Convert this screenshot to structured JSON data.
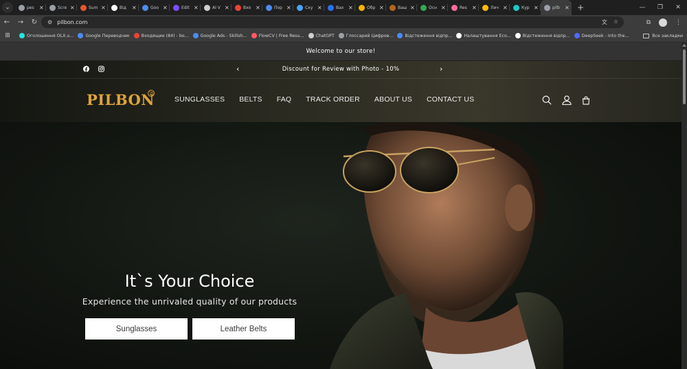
{
  "browser": {
    "tabs": [
      {
        "title": "pes",
        "color": "#9aa0a6"
      },
      {
        "title": "Scre",
        "color": "#9aa0a6"
      },
      {
        "title": "Sum",
        "color": "#e8542f"
      },
      {
        "title": "Від",
        "color": "#ffffff"
      },
      {
        "title": "Goo",
        "color": "#4c8bf5"
      },
      {
        "title": "Edit",
        "color": "#7c4dff"
      },
      {
        "title": "AI V",
        "color": "#cfcfcf"
      },
      {
        "title": "Вхо",
        "color": "#ea4335"
      },
      {
        "title": "Пор",
        "color": "#4c8bf5"
      },
      {
        "title": "Ску",
        "color": "#4aa3ff"
      },
      {
        "title": "Вах",
        "color": "#2f6fed"
      },
      {
        "title": "Обр",
        "color": "#f4b400"
      },
      {
        "title": "Ваш",
        "color": "#b5651d"
      },
      {
        "title": "Осн",
        "color": "#34a853"
      },
      {
        "title": "Res",
        "color": "#ff6b9d"
      },
      {
        "title": "Лич",
        "color": "#fbbc05"
      },
      {
        "title": "Кур",
        "color": "#1ec8c8"
      },
      {
        "title": "pilb",
        "color": "#9aa0a6",
        "active": true
      }
    ],
    "new_tab_label": "+",
    "url": "pilbon.com",
    "bookmarks": [
      {
        "label": "Оголошення OLX.u...",
        "color": "#23e5db"
      },
      {
        "label": "Google Переводчик",
        "color": "#4c8bf5"
      },
      {
        "label": "Входящие (84) - bo...",
        "color": "#ea4335"
      },
      {
        "label": "Google Ads - Skillsh...",
        "color": "#4c8bf5"
      },
      {
        "label": "FlowCV | Free Resu...",
        "color": "#ff5a5f"
      },
      {
        "label": "ChatGPT",
        "color": "#cfcfcf"
      },
      {
        "label": "Глоссарий Цифров...",
        "color": "#9aa0a6"
      },
      {
        "label": "Відстеження відпр...",
        "color": "#4c8bf5"
      },
      {
        "label": "Налаштування Eco...",
        "color": "#ffffff"
      },
      {
        "label": "Відстеження відпр...",
        "color": "#ffffff"
      },
      {
        "label": "DeepSeek - Into the...",
        "color": "#4d6bfe"
      }
    ],
    "all_bookmarks_label": "Все закладки"
  },
  "site": {
    "announcement": "Welcome to our store!",
    "promo": "Discount for Review with Photo - 10%",
    "logo": "PILBON",
    "logo_tm": "TM",
    "menu": [
      "SUNGLASSES",
      "BELTS",
      "FAQ",
      "TRACK ORDER",
      "ABOUT US",
      "CONTACT US"
    ],
    "hero": {
      "title": "It`s Your Choice",
      "subtitle": "Experience the unrivaled quality of our products",
      "buttons": [
        "Sunglasses",
        "Leather Belts"
      ]
    }
  },
  "colors": {
    "accent": "#e0a43a",
    "header_bg": "#2c2c22",
    "announcement_bg": "#333333"
  }
}
